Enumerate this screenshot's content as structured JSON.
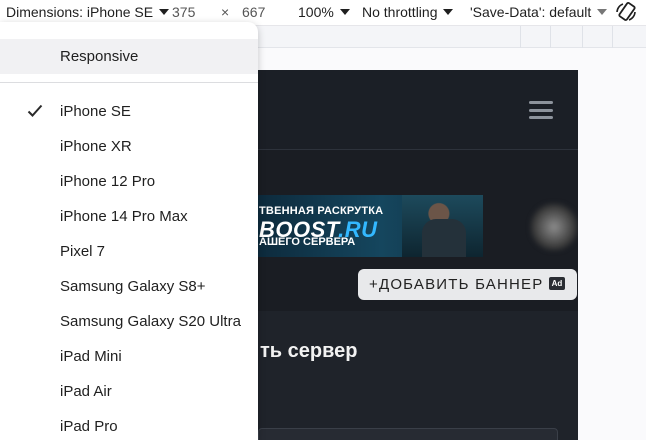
{
  "toolbar": {
    "dimensions_label": "Dimensions: iPhone SE",
    "width_value": "375",
    "times_symbol": "×",
    "height_value": "667",
    "zoom_label": "100%",
    "throttling_label": "No throttling",
    "save_data_label": "'Save-Data': default",
    "icons": {
      "dropdown": "chevron-down-icon",
      "rotate": "rotate-icon"
    }
  },
  "page": {
    "banner": {
      "line1": "ТВЕННАЯ РАСКРУТКА",
      "line2_main": "BOOST",
      "line2_accent": ".RU",
      "line3": "АШЕГО СЕРВЕРА"
    },
    "add_banner_label": "+ДОБАВИТЬ БАННЕР",
    "ad_badge": "Ad",
    "section_title": "ть сервер"
  },
  "menu": {
    "items": [
      {
        "label": "Responsive",
        "highlighted": true
      },
      {
        "label": "iPhone SE",
        "checked": true
      },
      {
        "label": "iPhone XR"
      },
      {
        "label": "iPhone 12 Pro"
      },
      {
        "label": "iPhone 14 Pro Max"
      },
      {
        "label": "Pixel 7"
      },
      {
        "label": "Samsung Galaxy S8+"
      },
      {
        "label": "Samsung Galaxy S20 Ultra"
      },
      {
        "label": "iPad Mini"
      },
      {
        "label": "iPad Air"
      },
      {
        "label": "iPad Pro"
      }
    ]
  },
  "colors": {
    "accent": "#33b8ff",
    "page_background": "#1a1d23",
    "menu_highlight": "#f1f1f3"
  }
}
